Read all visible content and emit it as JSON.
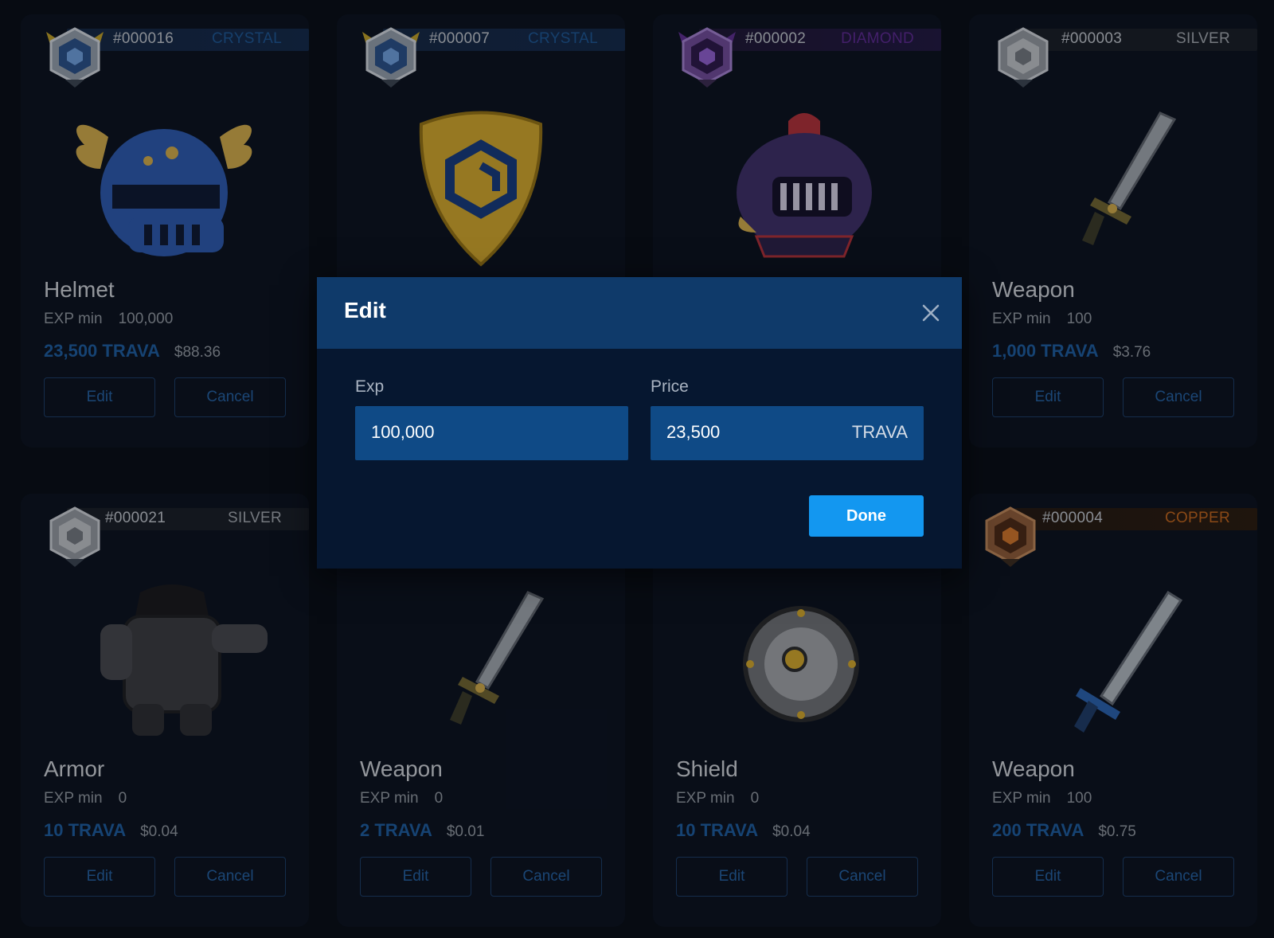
{
  "common": {
    "exp_label": "EXP min",
    "edit_label": "Edit",
    "cancel_label": "Cancel"
  },
  "cards": [
    {
      "id": "#000016",
      "tier": "CRYSTAL",
      "tier_color": "#1e5590",
      "name": "Helmet",
      "exp": "100,000",
      "price": "23,500 TRAVA",
      "usd": "$88.36",
      "item_icon": "winged-helmet-icon"
    },
    {
      "id": "#000007",
      "tier": "CRYSTAL",
      "tier_color": "#1e5590",
      "name": "Shield",
      "exp": "",
      "price": "",
      "usd": "",
      "item_icon": "gold-shield-icon"
    },
    {
      "id": "#000002",
      "tier": "DIAMOND",
      "tier_color": "#5a2a8e",
      "name": "Helmet",
      "exp": "",
      "price": "",
      "usd": "",
      "item_icon": "knight-helmet-icon"
    },
    {
      "id": "#000003",
      "tier": "SILVER",
      "tier_color": "#9ca2aa",
      "name": "Weapon",
      "exp": "100",
      "price": "1,000 TRAVA",
      "usd": "$3.76",
      "item_icon": "sword-icon"
    },
    {
      "id": "#000021",
      "tier": "SILVER",
      "tier_color": "#9ca2aa",
      "name": "Armor",
      "exp": "0",
      "price": "10 TRAVA",
      "usd": "$0.04",
      "item_icon": "armor-icon"
    },
    {
      "id": "",
      "tier": "",
      "tier_color": "#9ca2aa",
      "name": "Weapon",
      "exp": "0",
      "price": "2 TRAVA",
      "usd": "$0.01",
      "item_icon": "sword-icon"
    },
    {
      "id": "",
      "tier": "",
      "tier_color": "#9ca2aa",
      "name": "Shield",
      "exp": "0",
      "price": "10 TRAVA",
      "usd": "$0.04",
      "item_icon": "round-shield-icon"
    },
    {
      "id": "#000004",
      "tier": "COPPER",
      "tier_color": "#b8621f",
      "name": "Weapon",
      "exp": "100",
      "price": "200 TRAVA",
      "usd": "$0.75",
      "item_icon": "copper-sword-icon"
    }
  ],
  "modal": {
    "title": "Edit",
    "exp_label": "Exp",
    "exp_value": "100,000",
    "price_label": "Price",
    "price_value": "23,500",
    "price_unit": "TRAVA",
    "done_label": "Done"
  }
}
